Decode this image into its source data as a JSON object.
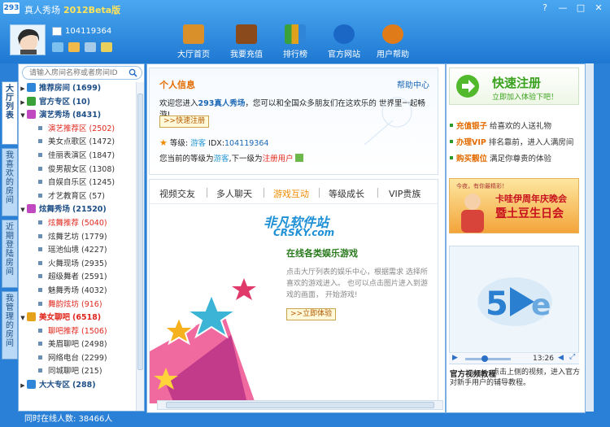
{
  "app": {
    "logo": "293",
    "title": "真人秀场",
    "version": "2012Beta版"
  },
  "window": {
    "help": "?",
    "minimize": "—",
    "maximize": "□",
    "close": "✕"
  },
  "user": {
    "id": "104119364"
  },
  "nav": [
    {
      "label": "大厅首页",
      "icon": "home-icon",
      "color": "#d9902b"
    },
    {
      "label": "我要充值",
      "icon": "wallet-icon",
      "color": "#8b4a1c"
    },
    {
      "label": "排行榜",
      "icon": "bar-chart-icon",
      "color": "#e0a21d"
    },
    {
      "label": "官方网站",
      "icon": "globe-icon",
      "color": "#1a67c6"
    },
    {
      "label": "用户帮助",
      "icon": "lifebuoy-icon",
      "color": "#e07b1a"
    }
  ],
  "side_tabs": [
    "大厅列表",
    "我喜欢的房间",
    "近期登陆房间",
    "我管理的房间"
  ],
  "search": {
    "placeholder": "请输入房间名称或者房间ID"
  },
  "tree": [
    {
      "type": "cat",
      "label": "推荐房间",
      "count": "(1699)",
      "color": "#2f86d8"
    },
    {
      "type": "cat",
      "label": "官方专区",
      "count": "(10)",
      "color": "#3aa03a"
    },
    {
      "type": "cat",
      "label": "演艺秀场",
      "count": "(8431)",
      "color": "#c048c0",
      "open": true
    },
    {
      "type": "sub",
      "label": "演艺推荐区",
      "count": "(2502)",
      "hot": true
    },
    {
      "type": "sub",
      "label": "美女点歌区",
      "count": "(1472)"
    },
    {
      "type": "sub",
      "label": "佳丽表演区",
      "count": "(1847)"
    },
    {
      "type": "sub",
      "label": "俊男靓女区",
      "count": "(1308)"
    },
    {
      "type": "sub",
      "label": "自娱自乐区",
      "count": "(1245)"
    },
    {
      "type": "sub",
      "label": "才艺教育区",
      "count": "(57)"
    },
    {
      "type": "cat",
      "label": "炫舞秀场",
      "count": "(21520)",
      "color": "#c048c0",
      "open": true
    },
    {
      "type": "sub",
      "label": "炫舞推荐",
      "count": "(5040)",
      "hot": true
    },
    {
      "type": "sub",
      "label": "炫舞艺坊",
      "count": "(1779)"
    },
    {
      "type": "sub",
      "label": "瑶池仙境",
      "count": "(4227)"
    },
    {
      "type": "sub",
      "label": "火舞现场",
      "count": "(2935)"
    },
    {
      "type": "sub",
      "label": "超级舞者",
      "count": "(2591)"
    },
    {
      "type": "sub",
      "label": "魅舞秀场",
      "count": "(4032)"
    },
    {
      "type": "sub",
      "label": "舞韵炫坊",
      "count": "(916)",
      "hot": true
    },
    {
      "type": "cat",
      "label": "美女聊吧",
      "count": "(6518)",
      "color": "#e6a21a",
      "open": true,
      "hot": true
    },
    {
      "type": "sub",
      "label": "聊吧推荐",
      "count": "(1506)",
      "hot": true
    },
    {
      "type": "sub",
      "label": "美眉聊吧",
      "count": "(2498)"
    },
    {
      "type": "sub",
      "label": "网络电台",
      "count": "(2299)"
    },
    {
      "type": "sub",
      "label": "同城聊吧",
      "count": "(215)"
    },
    {
      "type": "cat",
      "label": "大大专区",
      "count": "(288)",
      "color": "#2f86d8"
    }
  ],
  "status": {
    "online": "同时在线人数: 38466人"
  },
  "info": {
    "title": "个人信息",
    "help": "帮助中心",
    "welcome_pre": "欢迎您进入",
    "welcome_brand": "293真人秀场",
    "welcome_post": "，您可以和全国众多朋友们在这欢乐的 世界里一起畅游!",
    "quick_reg": ">>快速注册",
    "level_label": "等级:",
    "level_value": "游客",
    "idx_label": "IDX:",
    "idx_value": "104119364",
    "cur_pre": "您当前的等级为",
    "cur_level": "游客",
    "cur_mid": ",下一级为",
    "cur_next": "注册用户"
  },
  "tabs": [
    "视频交友",
    "多人聊天",
    "游戏互动",
    "等级成长",
    "VIP贵族"
  ],
  "active_tab": 2,
  "promo": {
    "watermark": "非凡软件站",
    "watermark2": "CRSKY.com",
    "title": "在线各类娱乐游戏",
    "text": "点击大厅列表的娱乐中心，根据需求 选择所喜欢的游戏进入。 也可以点击图片进入到游戏的画面， 开始游戏!",
    "button": ">>立即体验"
  },
  "register": {
    "title": "快速注册",
    "subtitle": "立即加入体验下吧！"
  },
  "links": [
    {
      "em": "充值银子",
      "text": "给喜欢的人送礼物"
    },
    {
      "em": "办理VIP",
      "text": "排名靠前，进入人满房间"
    },
    {
      "em": "购买靓位",
      "text": "满足你尊贵的体验"
    }
  ],
  "banner": {
    "sub": "今夜，有你最精彩！",
    "title": "卡哇伊周年庆晚会",
    "title2": "暨土豆生日会"
  },
  "video": {
    "time": "13:26"
  },
  "tutorial": {
    "title": "官方视频教程",
    "text": "点击上侧的视频，进入官方对新手用户的辅导教程。"
  }
}
